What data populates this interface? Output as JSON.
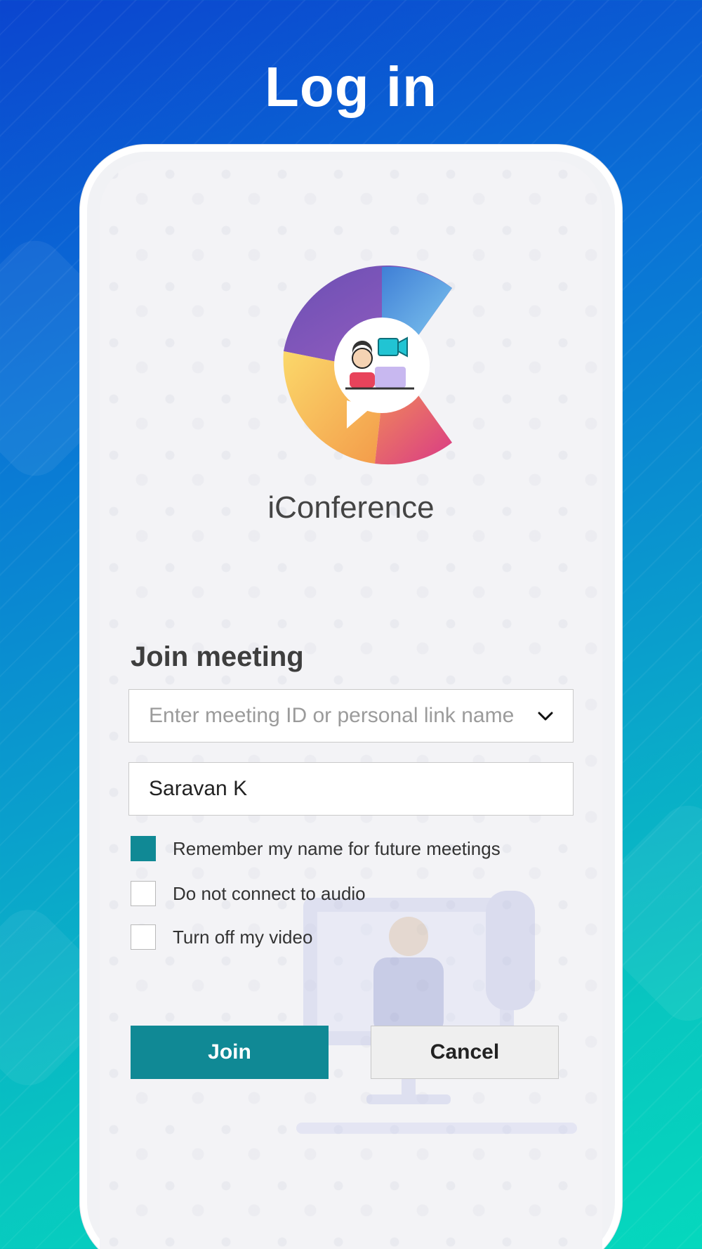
{
  "page": {
    "title": "Log in"
  },
  "app": {
    "name": "iConference",
    "logo_icon": "iconference-logo-icon"
  },
  "form": {
    "section_title": "Join meeting",
    "meeting_id": {
      "placeholder": "Enter meeting ID or personal link name",
      "value": "",
      "dropdown_icon": "chevron-down-icon"
    },
    "name": {
      "value": "Saravan K"
    },
    "options": [
      {
        "label": "Remember my name for future meetings",
        "checked": true
      },
      {
        "label": "Do not connect to audio",
        "checked": false
      },
      {
        "label": "Turn off my video",
        "checked": false
      }
    ],
    "join_label": "Join",
    "cancel_label": "Cancel"
  },
  "colors": {
    "accent": "#108995",
    "background_top": "#0b45cf",
    "background_bottom": "#05d8bd"
  }
}
